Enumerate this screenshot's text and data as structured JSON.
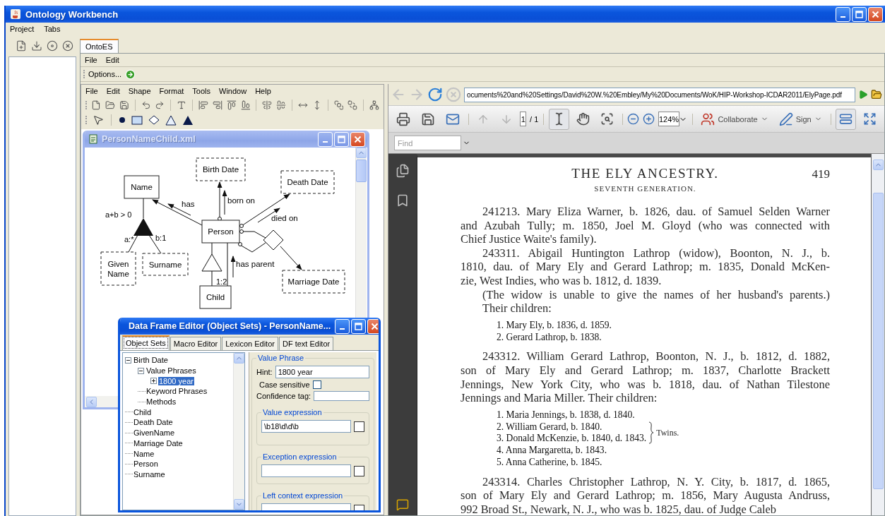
{
  "window": {
    "title": "Ontology Workbench"
  },
  "menu_bar": [
    "Project",
    "Tabs"
  ],
  "main_tabs": [
    {
      "label": "OntoES",
      "selected": true
    }
  ],
  "ontoes_menu": [
    "File",
    "Edit"
  ],
  "options_bar": {
    "label": "Options..."
  },
  "diagram_editor": {
    "menu": [
      "File",
      "Edit",
      "Shape",
      "Format",
      "Tools",
      "Window",
      "Help"
    ],
    "document_window": {
      "title": "PersonNameChild.xml",
      "diagram": {
        "nodes": [
          {
            "label": "Birth Date",
            "kind": "lexical"
          },
          {
            "label": "Name",
            "kind": "nonlexical"
          },
          {
            "label": "Death Date",
            "kind": "lexical"
          },
          {
            "label": "Person",
            "kind": "nonlexical"
          },
          {
            "label": "Given Name",
            "kind": "lexical"
          },
          {
            "label": "Surname",
            "kind": "lexical"
          },
          {
            "label": "Marriage Date",
            "kind": "lexical"
          },
          {
            "label": "Child",
            "kind": "nonlexical"
          }
        ],
        "relationship_labels": [
          "has",
          "born on",
          "died on",
          "has parent"
        ],
        "constraint_labels": [
          "a+b > 0",
          "a:*",
          "b:1",
          "1:2"
        ]
      }
    }
  },
  "data_frame_editor": {
    "title": "Data Frame Editor (Object Sets) - PersonName...",
    "tabs": [
      {
        "label": "Object Sets",
        "selected": true
      },
      {
        "label": "Macro Editor",
        "selected": false
      },
      {
        "label": "Lexicon Editor",
        "selected": false
      },
      {
        "label": "DF text Editor",
        "selected": false
      }
    ],
    "tree": [
      {
        "label": "Birth Date",
        "expanded": true,
        "selected": false,
        "children": [
          {
            "label": "Value Phrases",
            "expanded": true,
            "selected": false,
            "children": [
              {
                "label": "1800 year",
                "expanded": false,
                "selected": true
              }
            ]
          },
          {
            "label": "Keyword Phrases",
            "selected": false
          },
          {
            "label": "Methods",
            "selected": false
          }
        ]
      },
      {
        "label": "Child",
        "selected": false
      },
      {
        "label": "Death Date",
        "selected": false
      },
      {
        "label": "GivenName",
        "selected": false
      },
      {
        "label": "Marriage Date",
        "selected": false
      },
      {
        "label": "Name",
        "selected": false
      },
      {
        "label": "Person",
        "selected": false
      },
      {
        "label": "Surname",
        "selected": false
      }
    ],
    "value_phrase": {
      "legend": "Value Phrase",
      "hint_label": "Hint:",
      "hint": "1800 year",
      "case_sensitive_label": "Case sensitive",
      "case_sensitive": false,
      "confidence_label": "Confidence tag:",
      "sections": [
        {
          "legend": "Value expression",
          "value": "\\b18\\d\\d\\b"
        },
        {
          "legend": "Exception expression"
        },
        {
          "legend": "Left context expression"
        }
      ]
    }
  },
  "pdf_viewer": {
    "nav_buttons": [
      {
        "kind": "back",
        "disabled": true
      },
      {
        "kind": "forward",
        "disabled": true
      },
      {
        "kind": "refresh",
        "disabled": false
      },
      {
        "kind": "stop",
        "disabled": true
      }
    ],
    "address": "ocuments%20and%20Settings/David%20W.%20Embley/My%20Documents/WoK/HIP-Workshop-ICDAR2011/ElyPage.pdf",
    "page_buttons": [
      {
        "kind": "previous",
        "disabled": true
      },
      {
        "kind": "next",
        "disabled": true
      }
    ],
    "page_number": "1",
    "page_count": "/ 1",
    "tools": [
      {
        "kind": "select",
        "selected": true
      },
      {
        "kind": "hand",
        "selected": false
      },
      {
        "kind": "marquee",
        "selected": false
      }
    ],
    "zoom": "124%",
    "collaborate": "Collaborate",
    "sign": "Sign",
    "fit_buttons": [
      {
        "kind": "fit-width",
        "selected": true
      },
      {
        "kind": "fit-page",
        "selected": false
      }
    ],
    "find_placeholder": "Find",
    "page": {
      "heading": "THE ELY ANCESTRY.",
      "page_number": "419",
      "subheading": "SEVENTH GENERATION.",
      "blocks": [
        {
          "kind": "entry",
          "lines": [
            "241213. Mary Eliza Warner, b. 1826, dau. of Samuel Selden Warner",
            "and Azubah Tully; m. 1850, Joel M. Gloyd (who was connected with",
            "Chief Justice Waite's family)."
          ]
        },
        {
          "kind": "entry",
          "lines": [
            "243311. Abigail Huntington Lathrop (widow), Boonton, N. J., b.",
            "1810, dau. of Mary Ely and Gerard Lathrop; m. 1835, Donald McKen-",
            "zie, West Indies, who was b. 1812, d. 1839."
          ]
        },
        {
          "kind": "note",
          "lines": [
            "(The widow is unable to give the names of her husband's parents.)",
            "Their children:"
          ]
        },
        {
          "kind": "list",
          "items": [
            {
              "text": "1. Mary Ely, b. 1836, d. 1859.",
              "bracketed": false
            },
            {
              "text": "2. Gerard Lathrop, b. 1838.",
              "bracketed": false
            }
          ]
        },
        {
          "kind": "entry",
          "lines": [
            "243312. William Gerard Lathrop, Boonton, N. J., b. 1812, d. 1882,",
            "son of Mary Ely and Gerard Lathrop; m. 1837, Charlotte Brackett",
            "Jennings, New York City, who was b. 1818, dau. of Nathan Tilestone",
            "Jennings and Maria Miller.  Their children:"
          ]
        },
        {
          "kind": "list",
          "bracket_label": "Twins.",
          "items": [
            {
              "text": "1. Maria Jennings, b. 1838, d. 1840.",
              "bracketed": false
            },
            {
              "text": "2. William Gerard, b. 1840.",
              "bracketed": true
            },
            {
              "text": "3. Donald McKenzie, b. 1840, d. 1843.",
              "bracketed": true
            },
            {
              "text": "4. Anna Margaretta, b. 1843.",
              "bracketed": false
            },
            {
              "text": "5. Anna Catherine, b. 1845.",
              "bracketed": false
            }
          ]
        },
        {
          "kind": "entry",
          "lines": [
            "243314. Charles Christopher Lathrop, N. Y. City, b. 1817, d. 1865,",
            "son of Mary Ely and Gerard Lathrop; m. 1856, Mary Augusta Andruss,",
            "992 Broad St., Newark, N. J., who was b. 1825, dau. of Judge Caleb"
          ]
        }
      ]
    }
  }
}
